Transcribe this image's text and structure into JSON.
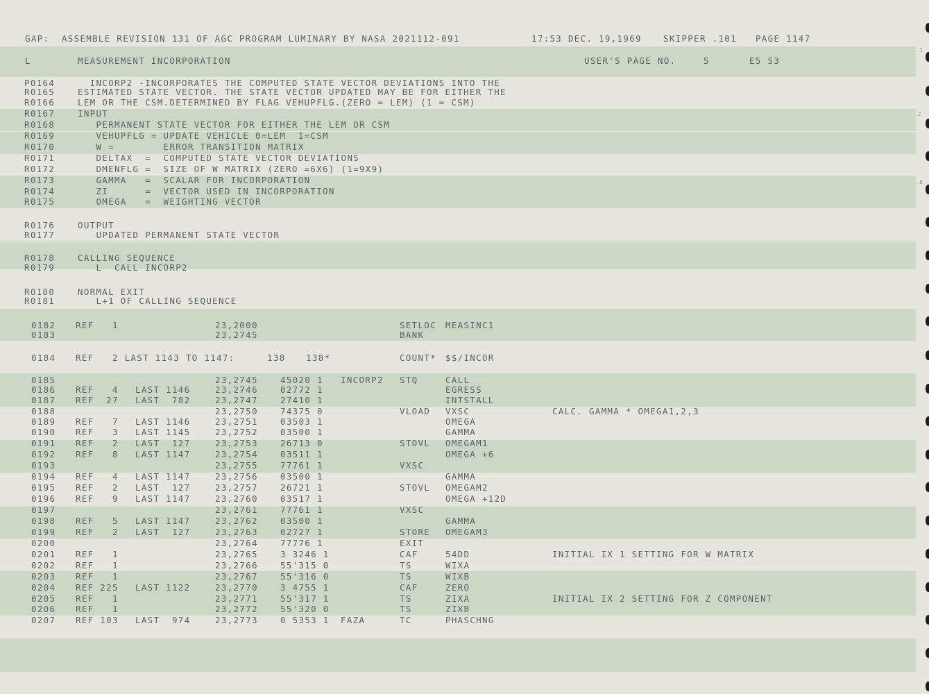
{
  "header": {
    "left": "GAP:  ASSEMBLE REVISION 131 OF AGC PROGRAM LUMINARY BY NASA 2021112-091",
    "timestamp": "17:53 DEC. 19,1969",
    "skipper": "SKIPPER .101",
    "page": "PAGE 1147"
  },
  "section": {
    "code": "L",
    "title": "MEASUREMENT INCORPORATION",
    "users_page_label": "USER'S PAGE NO.",
    "users_page_no": "5",
    "ref": "E5 S3"
  },
  "comments": [
    {
      "n": "P0164",
      "t": "  INCORP2 -INCORPORATES THE COMPUTED STATE VECTOR DEVIATIONS INTO THE"
    },
    {
      "n": "R0165",
      "t": "ESTIMATED STATE VECTOR. THE STATE VECTOR UPDATED MAY BE FOR EITHER THE"
    },
    {
      "n": "R0166",
      "t": "LEM OR THE CSM.DETERMINED BY FLAG VEHUPFLG.(ZERO = LEM) (1 = CSM)"
    },
    {
      "n": "R0167",
      "t": "INPUT"
    },
    {
      "n": "R0168",
      "t": "   PERMANENT STATE VECTOR FOR EITHER THE LEM OR CSM"
    },
    {
      "n": "R0169",
      "t": "   VEHUPFLG = UPDATE VEHICLE 0=LEM  1=CSM"
    },
    {
      "n": "R0170",
      "t": "   W =        ERROR TRANSITION MATRIX"
    },
    {
      "n": "R0171",
      "t": "   DELTAX  =  COMPUTED STATE VECTOR DEVIATIONS"
    },
    {
      "n": "R0172",
      "t": "   DMENFLG =  SIZE OF W MATRIX (ZERO =6X6) (1=9X9)"
    },
    {
      "n": "R0173",
      "t": "   GAMMA   =  SCALAR FOR INCORPORATION"
    },
    {
      "n": "R0174",
      "t": "   ZI      =  VECTOR USED IN INCORPORATION"
    },
    {
      "n": "R0175",
      "t": "   OMEGA   =  WEIGHTING VECTOR"
    },
    {
      "n": "R0176",
      "t": "OUTPUT"
    },
    {
      "n": "R0177",
      "t": "   UPDATED PERMANENT STATE VECTOR"
    },
    {
      "n": "R0178",
      "t": "CALLING SEQUENCE"
    },
    {
      "n": "R0179",
      "t": "   L  CALL INCORP2"
    },
    {
      "n": "R0180",
      "t": "NORMAL EXIT"
    },
    {
      "n": "R0181",
      "t": "   L+1 OF CALLING SEQUENCE"
    }
  ],
  "code_rows": [
    {
      "n": "0182",
      "ref": "REF   1",
      "last": "",
      "addr": "23,2000",
      "word": "",
      "label": "",
      "op": "SETLOC",
      "operand": "MEASINC1",
      "comment": ""
    },
    {
      "n": "0183",
      "ref": "",
      "last": "",
      "addr": "23,2745",
      "word": "",
      "label": "",
      "op": "BANK",
      "operand": "",
      "comment": ""
    },
    {
      "n": "0185",
      "ref": "",
      "last": "",
      "addr": "23,2745",
      "word": "45020 1",
      "label": "INCORP2",
      "op": "STQ",
      "operand": "CALL",
      "comment": ""
    },
    {
      "n": "0186",
      "ref": "REF   4",
      "last": "LAST 1146",
      "addr": "23,2746",
      "word": "02772 1",
      "label": "",
      "op": "",
      "operand": "EGRESS",
      "comment": ""
    },
    {
      "n": "0187",
      "ref": "REF  27",
      "last": "LAST  782",
      "addr": "23,2747",
      "word": "27410 1",
      "label": "",
      "op": "",
      "operand": "INTSTALL",
      "comment": ""
    },
    {
      "n": "0188",
      "ref": "",
      "last": "",
      "addr": "23,2750",
      "word": "74375 0",
      "label": "",
      "op": "VLOAD",
      "operand": "VXSC",
      "comment": "CALC. GAMMA * OMEGA1,2,3"
    },
    {
      "n": "0189",
      "ref": "REF   7",
      "last": "LAST 1146",
      "addr": "23,2751",
      "word": "03503 1",
      "label": "",
      "op": "",
      "operand": "OMEGA",
      "comment": ""
    },
    {
      "n": "0190",
      "ref": "REF   3",
      "last": "LAST 1145",
      "addr": "23,2752",
      "word": "03500 1",
      "label": "",
      "op": "",
      "operand": "GAMMA",
      "comment": ""
    },
    {
      "n": "0191",
      "ref": "REF   2",
      "last": "LAST  127",
      "addr": "23,2753",
      "word": "26713 0",
      "label": "",
      "op": "STOVL",
      "operand": "OMEGAM1",
      "comment": ""
    },
    {
      "n": "0192",
      "ref": "REF   8",
      "last": "LAST 1147",
      "addr": "23,2754",
      "word": "03511 1",
      "label": "",
      "op": "",
      "operand": "OMEGA +6",
      "comment": ""
    },
    {
      "n": "0193",
      "ref": "",
      "last": "",
      "addr": "23,2755",
      "word": "77761 1",
      "label": "",
      "op": "VXSC",
      "operand": "",
      "comment": ""
    },
    {
      "n": "0194",
      "ref": "REF   4",
      "last": "LAST 1147",
      "addr": "23,2756",
      "word": "03500 1",
      "label": "",
      "op": "",
      "operand": "GAMMA",
      "comment": ""
    },
    {
      "n": "0195",
      "ref": "REF   2",
      "last": "LAST  127",
      "addr": "23,2757",
      "word": "26721 1",
      "label": "",
      "op": "STOVL",
      "operand": "OMEGAM2",
      "comment": ""
    },
    {
      "n": "0196",
      "ref": "REF   9",
      "last": "LAST 1147",
      "addr": "23,2760",
      "word": "03517 1",
      "label": "",
      "op": "",
      "operand": "OMEGA +12D",
      "comment": ""
    },
    {
      "n": "0197",
      "ref": "",
      "last": "",
      "addr": "23,2761",
      "word": "77761 1",
      "label": "",
      "op": "VXSC",
      "operand": "",
      "comment": ""
    },
    {
      "n": "0198",
      "ref": "REF   5",
      "last": "LAST 1147",
      "addr": "23,2762",
      "word": "03500 1",
      "label": "",
      "op": "",
      "operand": "GAMMA",
      "comment": ""
    },
    {
      "n": "0199",
      "ref": "REF   2",
      "last": "LAST  127",
      "addr": "23,2763",
      "word": "02727 1",
      "label": "",
      "op": "STORE",
      "operand": "OMEGAM3",
      "comment": ""
    },
    {
      "n": "0200",
      "ref": "",
      "last": "",
      "addr": "23,2764",
      "word": "77776 1",
      "label": "",
      "op": "EXIT",
      "operand": "",
      "comment": ""
    },
    {
      "n": "0201",
      "ref": "REF   1",
      "last": "",
      "addr": "23,2765",
      "word": "3 3246 1",
      "label": "",
      "op": "CAF",
      "operand": "54DD",
      "comment": "INITIAL IX 1 SETTING FOR W MATRIX"
    },
    {
      "n": "0202",
      "ref": "REF   1",
      "last": "",
      "addr": "23,2766",
      "word": "55'315 0",
      "label": "",
      "op": "TS",
      "operand": "WIXA",
      "comment": ""
    },
    {
      "n": "0203",
      "ref": "REF   1",
      "last": "",
      "addr": "23,2767",
      "word": "55'316 0",
      "label": "",
      "op": "TS",
      "operand": "WIXB",
      "comment": ""
    },
    {
      "n": "0204",
      "ref": "REF 225",
      "last": "LAST 1122",
      "addr": "23,2770",
      "word": "3 4755 1",
      "label": "",
      "op": "CAF",
      "operand": "ZERO",
      "comment": ""
    },
    {
      "n": "0205",
      "ref": "REF   1",
      "last": "",
      "addr": "23,2771",
      "word": "55'317 1",
      "label": "",
      "op": "TS",
      "operand": "ZIXA",
      "comment": "INITIAL IX 2 SETTING FOR Z COMPONENT"
    },
    {
      "n": "0206",
      "ref": "REF   1",
      "last": "",
      "addr": "23,2772",
      "word": "55'320 0",
      "label": "",
      "op": "TS",
      "operand": "ZIXB",
      "comment": ""
    },
    {
      "n": "0207",
      "ref": "REF 103",
      "last": "LAST  974",
      "addr": "23,2773",
      "word": "0 5353 1",
      "label": "FAZA",
      "op": "TC",
      "operand": "PHASCHNG",
      "comment": ""
    }
  ],
  "count_row": {
    "n": "0184",
    "ref": "REF   2 LAST 1143 TO 1147:",
    "count1": "138",
    "count2": "138*",
    "op": "COUNT*",
    "operand": "$$/INCOR"
  },
  "margin_marks": [
    "..1",
    ".2",
    "..E"
  ],
  "colors": {
    "paper": "#e6e6df",
    "band": "#cbd8c5",
    "ink": "#5b6168"
  }
}
